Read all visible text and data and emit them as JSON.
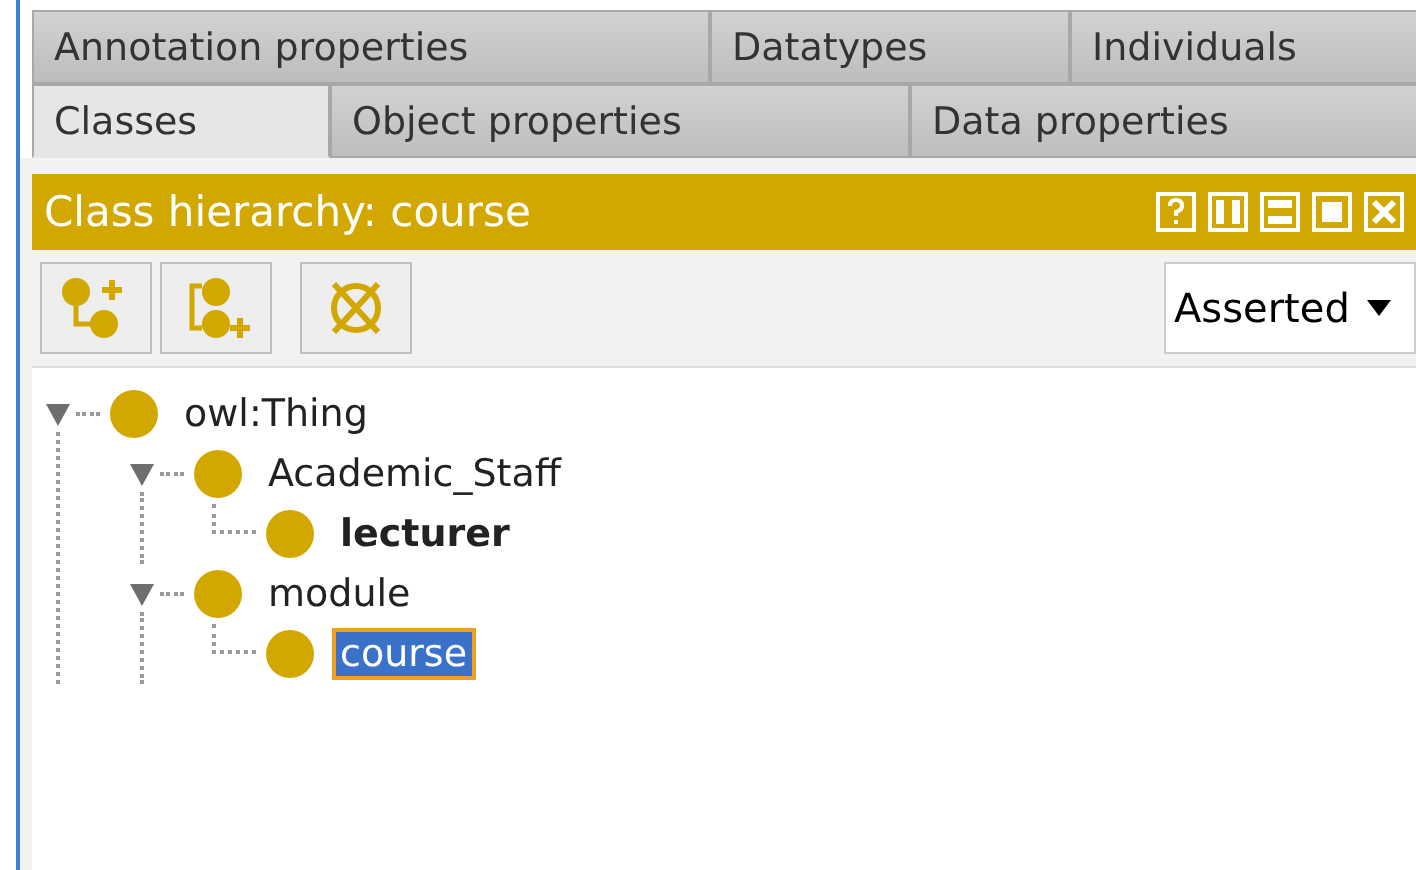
{
  "tab_rows": [
    [
      {
        "label": "Annotation properties",
        "selected": false
      },
      {
        "label": "Datatypes",
        "selected": false
      },
      {
        "label": "Individuals",
        "selected": false
      }
    ],
    [
      {
        "label": "Classes",
        "selected": true
      },
      {
        "label": "Object properties",
        "selected": false
      },
      {
        "label": "Data properties",
        "selected": false
      }
    ]
  ],
  "view": {
    "title": "Class hierarchy: course"
  },
  "toolbar": {
    "mode_dropdown": {
      "value": "Asserted"
    }
  },
  "tree": [
    {
      "label": "owl:Thing",
      "bold": false,
      "selected": false,
      "expanded": true,
      "children": [
        {
          "label": "Academic_Staff",
          "bold": false,
          "selected": false,
          "expanded": true,
          "children": [
            {
              "label": "lecturer",
              "bold": true,
              "selected": false
            }
          ]
        },
        {
          "label": "module",
          "bold": false,
          "selected": false,
          "expanded": true,
          "children": [
            {
              "label": "course",
              "bold": false,
              "selected": true
            }
          ]
        }
      ]
    }
  ]
}
